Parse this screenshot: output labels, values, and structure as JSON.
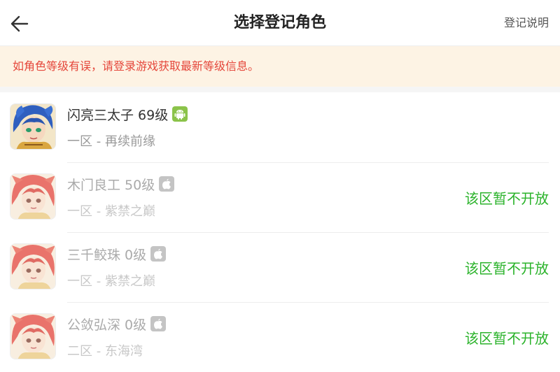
{
  "header": {
    "title": "选择登记角色",
    "help_label": "登记说明",
    "back_icon": "back-arrow-icon"
  },
  "notice": {
    "text": "如角色等级有误，请登录游戏获取最新等级信息。",
    "color": "#e5473b",
    "background": "#fdf3e4"
  },
  "roles": [
    {
      "name": "闪亮三太子 69级",
      "server": "一区 - 再续前缘",
      "platform": "android",
      "status": "",
      "enabled": true
    },
    {
      "name": "木门良工 50级",
      "server": "一区 - 紫禁之巅",
      "platform": "apple",
      "status": "该区暂不开放",
      "enabled": false
    },
    {
      "name": "三千鲛珠 0级",
      "server": "一区 - 紫禁之巅",
      "platform": "apple",
      "status": "该区暂不开放",
      "enabled": false
    },
    {
      "name": "公敛弘深 0级",
      "server": "二区 - 东海湾",
      "platform": "apple",
      "status": "该区暂不开放",
      "enabled": false
    }
  ],
  "colors": {
    "status_green": "#2bb32b",
    "android_green": "#8bc34a",
    "apple_gray": "#c4c4c4"
  }
}
